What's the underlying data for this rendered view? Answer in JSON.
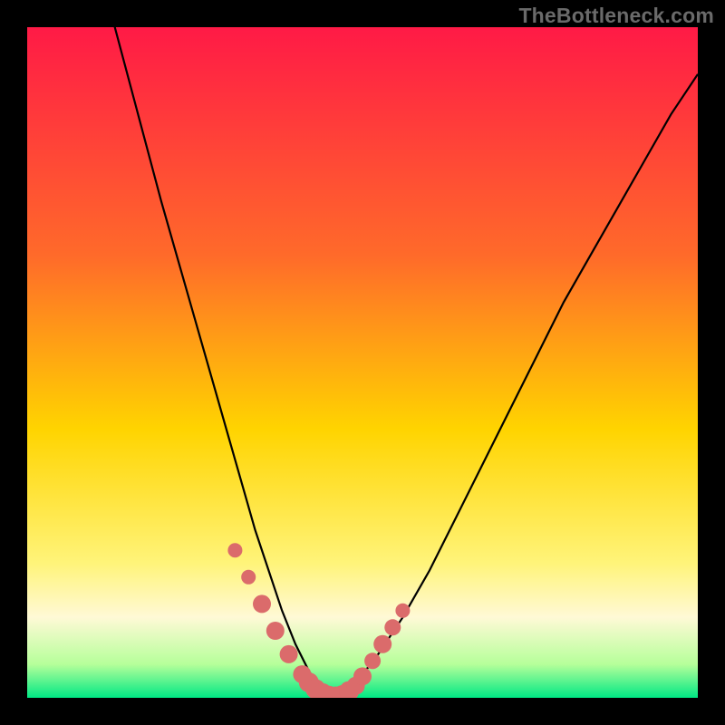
{
  "watermark": "TheBottleneck.com",
  "colors": {
    "frame": "#000000",
    "watermark_text": "#6a6a6a",
    "gradient_top": "#ff1a46",
    "gradient_mid_upper": "#ff6a2a",
    "gradient_mid": "#ffd400",
    "gradient_mid_lower": "#fff47a",
    "gradient_band": "#fff9d6",
    "gradient_near_bottom": "#b6ff9a",
    "gradient_bottom": "#00e884",
    "curve_stroke": "#000000",
    "marker_fill": "#db6b6b"
  },
  "chart_data": {
    "type": "line",
    "title": "",
    "xlabel": "",
    "ylabel": "",
    "xlim": [
      0,
      100
    ],
    "ylim": [
      0,
      100
    ],
    "series": [
      {
        "name": "bottleneck-curve",
        "x": [
          0,
          4,
          8,
          12,
          16,
          20,
          24,
          28,
          30,
          32,
          34,
          36,
          38,
          40,
          42,
          44,
          46,
          48,
          52,
          56,
          60,
          64,
          68,
          72,
          76,
          80,
          84,
          88,
          92,
          96,
          100
        ],
        "y": [
          152,
          136,
          120,
          104,
          89,
          74,
          60,
          46,
          39,
          32,
          25,
          19,
          13,
          8,
          4,
          1,
          0,
          1,
          6,
          12,
          19,
          27,
          35,
          43,
          51,
          59,
          66,
          73,
          80,
          87,
          93
        ]
      }
    ],
    "markers": {
      "name": "highlight-points",
      "x": [
        31,
        33,
        35,
        37,
        39,
        41,
        42,
        43,
        44,
        45,
        46,
        47,
        48,
        49,
        50,
        51.5,
        53,
        54.5,
        56
      ],
      "y": [
        22,
        18,
        14,
        10,
        6.5,
        3.5,
        2.3,
        1.3,
        0.7,
        0.3,
        0.2,
        0.4,
        1,
        1.8,
        3.2,
        5.5,
        8,
        10.5,
        13
      ],
      "r": [
        8,
        8,
        10,
        10,
        10,
        10,
        11,
        11,
        11,
        11,
        11,
        11,
        11,
        10,
        10,
        9,
        10,
        9,
        8
      ]
    },
    "gradient_stops": [
      {
        "offset": 0,
        "color_key": "gradient_top"
      },
      {
        "offset": 34,
        "color_key": "gradient_mid_upper"
      },
      {
        "offset": 60,
        "color_key": "gradient_mid"
      },
      {
        "offset": 80,
        "color_key": "gradient_mid_lower"
      },
      {
        "offset": 88,
        "color_key": "gradient_band"
      },
      {
        "offset": 95,
        "color_key": "gradient_near_bottom"
      },
      {
        "offset": 100,
        "color_key": "gradient_bottom"
      }
    ]
  }
}
